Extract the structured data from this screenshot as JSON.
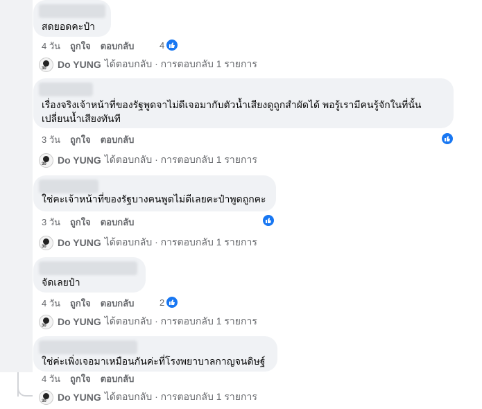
{
  "comments": [
    {
      "text_lines": [
        "สดยอดคะป๋า"
      ],
      "time": "4 วัน",
      "like_label": "ถูกใจ",
      "reply_label": "ตอบกลับ",
      "reaction_count": "4",
      "replier": "Do YUNG",
      "reply_text": "ได้ตอบกลับ · การตอบกลับ 1 รายการ"
    },
    {
      "text_lines": [
        "เรื่องจริงเจ้าหน้าที่ของรัฐพูดจาไม่ดีเจอมากับตัวน้ำเสียงดูถูกสำผัดได้ พอรู้เรามีคนรู้จักในที่นั้น",
        "เปลี่ยนน้ำเสียงทันที"
      ],
      "time": "3 วัน",
      "like_label": "ถูกใจ",
      "reply_label": "ตอบกลับ",
      "reaction_count": "",
      "replier": "Do YUNG",
      "reply_text": "ได้ตอบกลับ · การตอบกลับ 1 รายการ"
    },
    {
      "text_lines": [
        "ใช่คะเจ้าหน้าที่ของรัฐบางคนพูดไม่ดีเลยคะป๋าพูดถูกคะ"
      ],
      "time": "3 วัน",
      "like_label": "ถูกใจ",
      "reply_label": "ตอบกลับ",
      "reaction_count": "",
      "replier": "Do YUNG",
      "reply_text": "ได้ตอบกลับ · การตอบกลับ 1 รายการ"
    },
    {
      "text_lines": [
        "จัดเลยป๋า"
      ],
      "time": "4 วัน",
      "like_label": "ถูกใจ",
      "reply_label": "ตอบกลับ",
      "reaction_count": "2",
      "replier": "Do YUNG",
      "reply_text": "ได้ตอบกลับ · การตอบกลับ 1 รายการ"
    },
    {
      "text_lines": [
        "ใช่ค่ะเพิ่งเจอมาเหมือนกันค่ะที่โรงพยาบาลกาญจนดิษฐ์"
      ],
      "time": "4 วัน",
      "like_label": "ถูกใจ",
      "reply_label": "ตอบกลับ",
      "reaction_count": "",
      "replier": "Do YUNG",
      "reply_text": "ได้ตอบกลับ · การตอบกลับ 1 รายการ"
    }
  ],
  "colors": {
    "bubble": "#f0f2f5",
    "like_blue": "#1877f2",
    "secondary_text": "#65676b"
  },
  "icons": {
    "reaction": "like-thumb-icon",
    "avatar": "avatar"
  }
}
